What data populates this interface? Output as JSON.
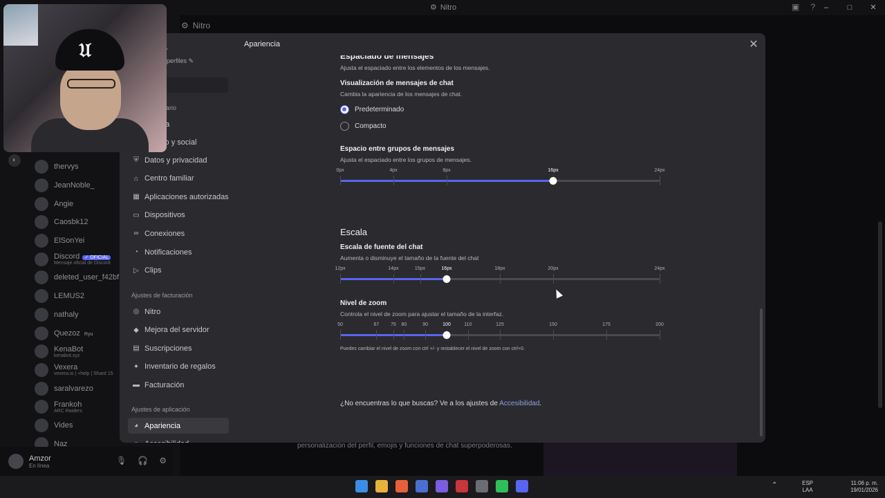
{
  "window": {
    "title": "Nitro",
    "icon": "nitro-icon"
  },
  "background": {
    "nitro_label": "Nitro",
    "members": [
      {
        "name": "thervys",
        "sub": ""
      },
      {
        "name": "JeanNoble_",
        "sub": ""
      },
      {
        "name": "Angie",
        "sub": ""
      },
      {
        "name": "Caosbk12",
        "sub": ""
      },
      {
        "name": "ElSonYei",
        "sub": ""
      },
      {
        "name": "Discord",
        "sub": "Mensaje oficial de Discord",
        "badge": "OFICIAL"
      },
      {
        "name": "deleted_user_f42bf",
        "sub": ""
      },
      {
        "name": "LEMUS2",
        "sub": ""
      },
      {
        "name": "nathaly",
        "sub": ""
      },
      {
        "name": "Quezoz",
        "sub": "",
        "tag": "Ryu"
      },
      {
        "name": "KenaBot",
        "sub": "kenabot.xyz"
      },
      {
        "name": "Vexera",
        "sub": "vexera.io | +help | Shard 15"
      },
      {
        "name": "saralvarezo",
        "sub": ""
      },
      {
        "name": "Frankoh",
        "sub": "ARC Raiders"
      },
      {
        "name": "Vides",
        "sub": ""
      },
      {
        "name": "Naz",
        "sub": ""
      }
    ],
    "user": {
      "name": "Amzor",
      "status": "En línea"
    },
    "promo_text": "personalización del perfil, emojis y funciones de chat superpoderosas."
  },
  "modal": {
    "header_title": "Apariencia",
    "profile_name": "nzor",
    "profile_edit": "tar perfiles",
    "sections_partial": {
      "usuario": "uario",
      "cuenta": "nta",
      "contenido": "ido y social"
    },
    "nav_user": [
      {
        "label": "Datos y privacidad",
        "icon": "shield-icon"
      },
      {
        "label": "Centro familiar",
        "icon": "family-icon"
      },
      {
        "label": "Aplicaciones autorizadas",
        "icon": "apps-icon"
      },
      {
        "label": "Dispositivos",
        "icon": "device-icon"
      },
      {
        "label": "Conexiones",
        "icon": "link-icon"
      },
      {
        "label": "Notificaciones",
        "icon": "bell-icon"
      },
      {
        "label": "Clips",
        "icon": "clip-icon"
      }
    ],
    "billing_title": "Ajustes de facturación",
    "nav_billing": [
      {
        "label": "Nitro",
        "icon": "nitro-icon"
      },
      {
        "label": "Mejora del servidor",
        "icon": "boost-icon"
      },
      {
        "label": "Suscripciones",
        "icon": "subscriptions-icon"
      },
      {
        "label": "Inventario de regalos",
        "icon": "gift-icon"
      },
      {
        "label": "Facturación",
        "icon": "card-icon"
      }
    ],
    "app_title": "Ajustes de aplicación",
    "nav_app": [
      {
        "label": "Apariencia",
        "icon": "palette-icon",
        "active": true
      },
      {
        "label": "Accesibilidad",
        "icon": "accessibility-icon"
      }
    ],
    "content": {
      "spacing_title": "Espaciado de mensajes",
      "spacing_desc": "Ajusta el espaciado entre los elementos de los mensajes.",
      "display_title": "Visualización de mensajes de chat",
      "display_desc": "Cambia la apariencia de los mensajes de chat.",
      "radio_default": "Predeterminado",
      "radio_compact": "Compacto",
      "display_selected": "Predeterminado",
      "group_title": "Espacio entre grupos de mensajes",
      "group_desc": "Ajusta el espaciado entre los grupos de mensajes.",
      "group_slider": {
        "labels": [
          "0px",
          "4px",
          "8px",
          "16px",
          "24px"
        ],
        "values": [
          0,
          4,
          8,
          16,
          24
        ],
        "min": 0,
        "max": 24,
        "value": 16,
        "selected_label": "16px"
      },
      "scale_title": "Escala",
      "font_title": "Escala de fuente del chat",
      "font_desc": "Aumenta o disminuye el tamaño de la fuente del chat",
      "font_slider": {
        "labels": [
          "12px",
          "14px",
          "15px",
          "16px",
          "18px",
          "20px",
          "24px"
        ],
        "values": [
          12,
          14,
          15,
          16,
          18,
          20,
          24
        ],
        "min": 12,
        "max": 24,
        "value": 16,
        "selected_label": "16px"
      },
      "zoom_title": "Nivel de zoom",
      "zoom_desc": "Controla el nivel de zoom para ajustar el tamaño de la interfaz.",
      "zoom_slider": {
        "labels": [
          "50",
          "67",
          "75",
          "80",
          "90",
          "100",
          "110",
          "125",
          "150",
          "175",
          "200"
        ],
        "values": [
          50,
          67,
          75,
          80,
          90,
          100,
          110,
          125,
          150,
          175,
          200
        ],
        "min": 50,
        "max": 200,
        "value": 100,
        "selected_label": "100"
      },
      "zoom_hint": "Puedes cambiar el nivel de zoom con ctrl +/- y restablecer el nivel de zoom con ctrl+0.",
      "footer_text": "¿No encuentras lo que buscas? Ve a los ajustes de ",
      "footer_link": "Accesibilidad",
      "footer_end": "."
    }
  },
  "taskbar": {
    "lang_top": "ESP",
    "lang_bottom": "LAA",
    "time": "11:06 p. m.",
    "date": "19/01/2026",
    "apps": [
      "windows-icon",
      "file-explorer-icon",
      "brave-icon",
      "store-icon",
      "game-icon",
      "media-icon",
      "steam-icon",
      "whatsapp-icon",
      "discord-icon"
    ]
  },
  "colors": {
    "accent": "#5865f2",
    "link": "#8ea1e1",
    "modal_bg": "#2b2a2e"
  }
}
